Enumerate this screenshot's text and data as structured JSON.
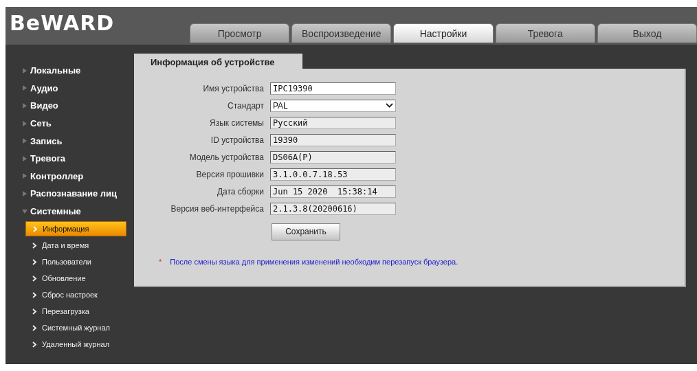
{
  "header": {
    "logo": "BeWARD",
    "tabs": [
      {
        "label": "Просмотр",
        "selected": false
      },
      {
        "label": "Воспроизведение",
        "selected": false
      },
      {
        "label": "Настройки",
        "selected": true
      },
      {
        "label": "Тревога",
        "selected": false
      },
      {
        "label": "Выход",
        "selected": false
      }
    ]
  },
  "sidebar": {
    "items": [
      {
        "label": "Локальные",
        "expanded": false
      },
      {
        "label": "Аудио",
        "expanded": false
      },
      {
        "label": "Видео",
        "expanded": false
      },
      {
        "label": "Сеть",
        "expanded": false
      },
      {
        "label": "Запись",
        "expanded": false
      },
      {
        "label": "Тревога",
        "expanded": false
      },
      {
        "label": "Контроллер",
        "expanded": false
      },
      {
        "label": "Распознавание лиц",
        "expanded": false
      },
      {
        "label": "Системные",
        "expanded": true,
        "children": [
          {
            "label": "Информация",
            "selected": true
          },
          {
            "label": "Дата и время",
            "selected": false
          },
          {
            "label": "Пользователи",
            "selected": false
          },
          {
            "label": "Обновление",
            "selected": false
          },
          {
            "label": "Сброс настроек",
            "selected": false
          },
          {
            "label": "Перезагрузка",
            "selected": false
          },
          {
            "label": "Системный журнал",
            "selected": false
          },
          {
            "label": "Удаленный журнал",
            "selected": false
          }
        ]
      }
    ]
  },
  "panel": {
    "title": "Информация об устройстве",
    "fields": [
      {
        "label": "Имя устройства",
        "kind": "text",
        "value": "IPC19390"
      },
      {
        "label": "Стандарт",
        "kind": "select",
        "value": "PAL"
      },
      {
        "label": "Язык системы",
        "kind": "readonly",
        "value": "Русский"
      },
      {
        "label": "ID устройства",
        "kind": "readonly",
        "value": "19390"
      },
      {
        "label": "Модель устройства",
        "kind": "readonly",
        "value": "DS06A(P)"
      },
      {
        "label": "Версия прошивки",
        "kind": "readonly",
        "value": "3.1.0.0.7.18.53"
      },
      {
        "label": "Дата сборки",
        "kind": "readonly",
        "value": "Jun 15 2020  15:38:14"
      },
      {
        "label": "Версия веб-интерфейса",
        "kind": "readonly",
        "value": "2.1.3.8(20200616)"
      }
    ],
    "save_button": "Сохранить",
    "note_mark": "*",
    "note": "После смены языка для применения изменений необходим перезапуск браузера."
  }
}
